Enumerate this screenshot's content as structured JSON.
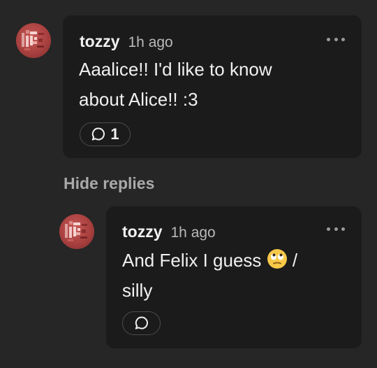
{
  "comments": [
    {
      "username": "tozzy",
      "time": "1h ago",
      "lines": [
        "Aaalice!! I'd like to know",
        "about Alice!! :3"
      ],
      "reply_count": "1",
      "avatar_icon": "pixel-art-avatar-icon"
    }
  ],
  "thread": {
    "toggle_label": "Hide replies"
  },
  "replies": [
    {
      "username": "tozzy",
      "time": "1h ago",
      "line1": "And Felix I guess",
      "line1_suffix": "/",
      "line2": "silly",
      "emoji": "face-with-rolling-eyes-icon",
      "avatar_icon": "pixel-art-avatar-icon"
    }
  ],
  "colors": {
    "background": "#262626",
    "card": "#1b1b1b",
    "avatar": "#b24745",
    "muted_text": "#a9a9a9"
  }
}
